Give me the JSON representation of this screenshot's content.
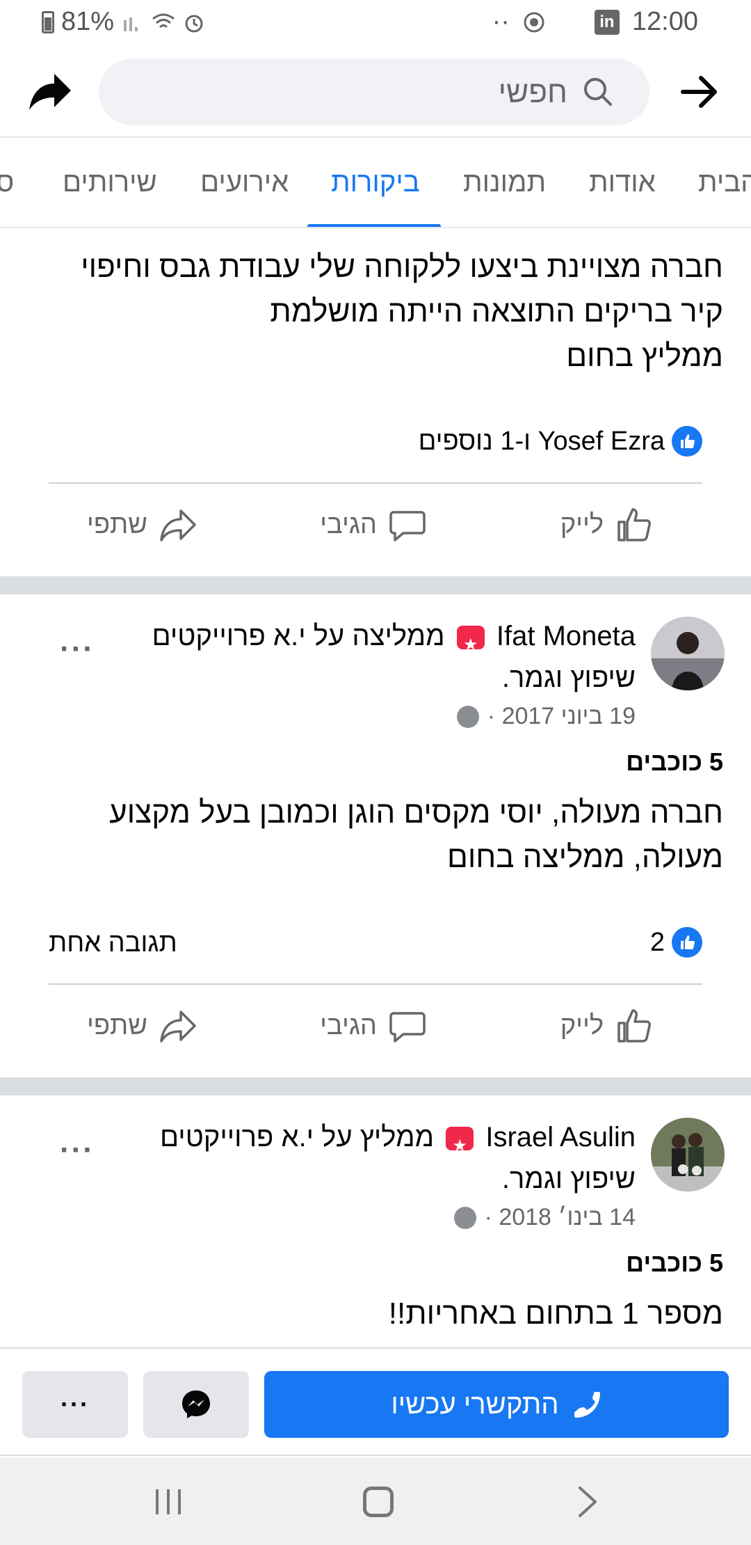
{
  "status_bar": {
    "battery": "81%",
    "time": "12:00",
    "dots": "··"
  },
  "header": {
    "search_placeholder": "חפשי"
  },
  "tabs": [
    {
      "label": "הבית"
    },
    {
      "label": "אודות"
    },
    {
      "label": "תמונות"
    },
    {
      "label": "ביקורות",
      "active": true
    },
    {
      "label": "אירועים"
    },
    {
      "label": "שירותים"
    },
    {
      "label": "ס"
    }
  ],
  "post1": {
    "text_lines": [
      "חברה מצויינת ביצעו ללקוחה שלי עבודת גבס וחיפוי",
      "קיר בריקים  התוצאה הייתה מושלמת",
      "ממליץ בחום"
    ],
    "reactions_text": "Yosef Ezra ו-1 נוספים"
  },
  "actions": {
    "like": "לייק",
    "comment": "הגיבי",
    "share": "שתפי"
  },
  "review1": {
    "author": "Ifat Moneta",
    "recommends": "ממליצה על י.א פרוייקטים",
    "recommends_line2": "שיפוץ וגמר.",
    "date": "19 ביוני 2017 ·",
    "stars": "5 כוכבים",
    "text_lines": [
      "חברה מעולה, יוסי מקסים הוגן וכמובן בעל מקצוע",
      "מעולה, ממליצה בחום"
    ],
    "likes": "2",
    "comments": "תגובה אחת"
  },
  "review2": {
    "author": "Israel Asulin",
    "recommends": "ממליץ על י.א פרוייקטים",
    "recommends_line2": "שיפוץ וגמר.",
    "date": "14 בינו׳ 2018 ·",
    "stars": "5 כוכבים",
    "text_lines": [
      "מספר 1 בתחום באחריות!!"
    ]
  },
  "bottom_bar": {
    "call_label": "התקשרי עכשיו",
    "more_label": "···"
  },
  "colors": {
    "accent": "#1877f2",
    "badge": "#f02849",
    "muted": "#65676b",
    "separator": "#dadde1"
  }
}
